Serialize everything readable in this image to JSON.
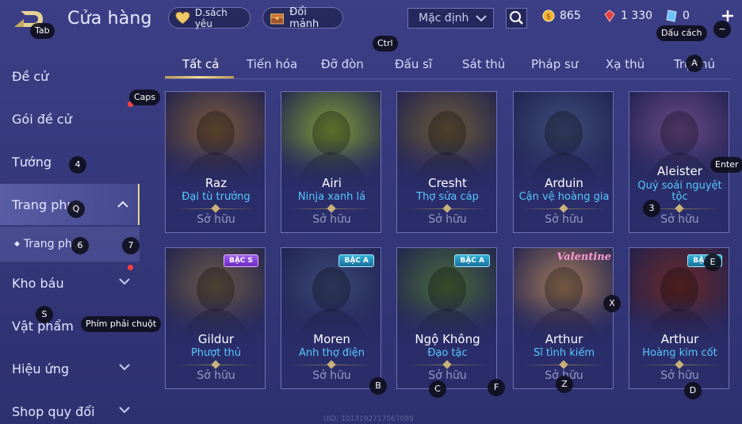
{
  "header": {
    "title": "Cửa hàng",
    "favorites_label": "D.sách yêu",
    "swap_label": "Đổi mảnh",
    "sort_value": "Mặc định",
    "currencies": [
      {
        "name": "gold",
        "value": "865",
        "color": "#f2b233"
      },
      {
        "name": "ruby",
        "value": "1 330",
        "color": "#e0433f"
      },
      {
        "name": "voucher",
        "value": "0",
        "color": "#6fc1ff"
      }
    ]
  },
  "tabs": [
    "Tất cả",
    "Tiến hóa",
    "Đỡ đòn",
    "Đấu sĩ",
    "Sát thủ",
    "Pháp sư",
    "Xạ thủ",
    "Trợ thủ"
  ],
  "sidebar": {
    "items": [
      {
        "label": "Đề cử"
      },
      {
        "label": "Gói đề cử"
      },
      {
        "label": "Tướng"
      },
      {
        "label": "Trang phục"
      },
      {
        "label": "Trang phục"
      },
      {
        "label": "Kho báu"
      },
      {
        "label": "Vật phẩm"
      },
      {
        "label": "Hiệu ứng"
      },
      {
        "label": "Shop quy đổi"
      }
    ]
  },
  "cards": [
    {
      "hero": "Raz",
      "skin": "Đại tù trưởng",
      "status": "Sở hữu",
      "tier": "",
      "art_color": "#7a5a3c"
    },
    {
      "hero": "Airi",
      "skin": "Ninja xanh lá",
      "status": "Sở hữu",
      "tier": "",
      "art_color": "#7f9a3a"
    },
    {
      "hero": "Cresht",
      "skin": "Thợ sửa cáp",
      "status": "Sở hữu",
      "tier": "",
      "art_color": "#6b5a3a"
    },
    {
      "hero": "Arduin",
      "skin": "Cận vệ hoàng gia",
      "status": "Sở hữu",
      "tier": "",
      "art_color": "#3e4e78"
    },
    {
      "hero": "Aleister",
      "skin": "Quỷ soái nguyệt tộc",
      "status": "Sở hữu",
      "tier": "",
      "art_color": "#6a4a86"
    },
    {
      "hero": "Gildur",
      "skin": "Phượt thủ",
      "status": "Sở hữu",
      "tier": "BẬC S",
      "art_color": "#6b5a48"
    },
    {
      "hero": "Moren",
      "skin": "Anh thợ điện",
      "status": "Sở hữu",
      "tier": "BẬC A",
      "art_color": "#3c4a78"
    },
    {
      "hero": "Ngộ Không",
      "skin": "Đạo tặc",
      "status": "Sở hữu",
      "tier": "BẬC A",
      "art_color": "#4a6a3c"
    },
    {
      "hero": "Arthur",
      "skin": "Sĩ tình kiếm",
      "status": "Sở hữu",
      "tier": "",
      "badge": "Valentine",
      "art_color": "#a07a5a"
    },
    {
      "hero": "Arthur",
      "skin": "Hoàng kim cốt",
      "status": "Sở hữu",
      "tier": "BẬC E",
      "art_color": "#6a2a2a"
    }
  ],
  "key_hints": {
    "tab": "Tab",
    "ctrl": "Ctrl",
    "space": "Dấu cách",
    "tilde": "~",
    "a": "A",
    "caps": "Caps",
    "enter": "Enter",
    "n4": "4",
    "q": "Q",
    "n6": "6",
    "n7": "7",
    "n3": "3",
    "s": "S",
    "rmb": "Phím phải chuột",
    "x": "X",
    "b": "B",
    "c": "C",
    "f": "F",
    "z": "Z",
    "d": "D",
    "e": "E"
  },
  "footer": {
    "uid": "UID: 1013192717567089"
  }
}
